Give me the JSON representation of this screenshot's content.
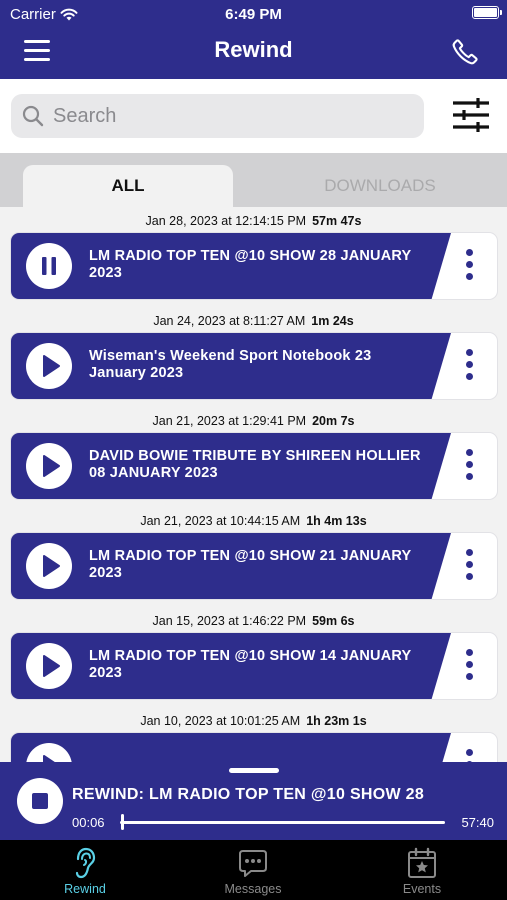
{
  "status_bar": {
    "carrier": "Carrier",
    "time": "6:49 PM",
    "battery_level": 0.92
  },
  "header": {
    "title": "Rewind",
    "menu_icon": "hamburger-menu-icon",
    "phone_icon": "phone-icon"
  },
  "search": {
    "placeholder": "Search",
    "value": ""
  },
  "tabs": [
    {
      "label": "ALL",
      "active": true
    },
    {
      "label": "DOWNLOADS",
      "active": false
    }
  ],
  "episodes": [
    {
      "date": "Jan 28, 2023 at 12:14:15 PM",
      "duration": "57m 47s",
      "title": "LM RADIO TOP TEN @10 SHOW 28 JANUARY 2023",
      "state": "pause"
    },
    {
      "date": "Jan 24, 2023 at 8:11:27 AM",
      "duration": "1m 24s",
      "title": "Wiseman's Weekend Sport Notebook 23 January 2023",
      "state": "play"
    },
    {
      "date": "Jan 21, 2023 at 1:29:41 PM",
      "duration": "20m 7s",
      "title": "DAVID BOWIE TRIBUTE BY SHIREEN HOLLIER 08 JANUARY 2023",
      "state": "play"
    },
    {
      "date": "Jan 21, 2023 at 10:44:15 AM",
      "duration": "1h 4m 13s",
      "title": "LM RADIO TOP TEN @10 SHOW 21 JANUARY 2023",
      "state": "play"
    },
    {
      "date": "Jan 15, 2023 at 1:46:22 PM",
      "duration": "59m 6s",
      "title": "LM RADIO TOP TEN @10 SHOW 14 JANUARY 2023",
      "state": "play"
    },
    {
      "date": "Jan 10, 2023 at 10:01:25 AM",
      "duration": "1h 23m 1s",
      "title": "",
      "state": "play"
    }
  ],
  "player": {
    "title": "REWIND: LM RADIO TOP TEN @10 SHOW 28",
    "current_time": "00:06",
    "total_time": "57:40",
    "progress": 0.002
  },
  "tabbar": [
    {
      "label": "Rewind",
      "icon": "ear-icon",
      "selected": true
    },
    {
      "label": "Messages",
      "icon": "chat-bubble-icon",
      "selected": false
    },
    {
      "label": "Events",
      "icon": "calendar-star-icon",
      "selected": false
    }
  ],
  "colors": {
    "brand": "#2e2d8c",
    "accent": "#5ad0e6",
    "background": "#f2f2f2"
  }
}
